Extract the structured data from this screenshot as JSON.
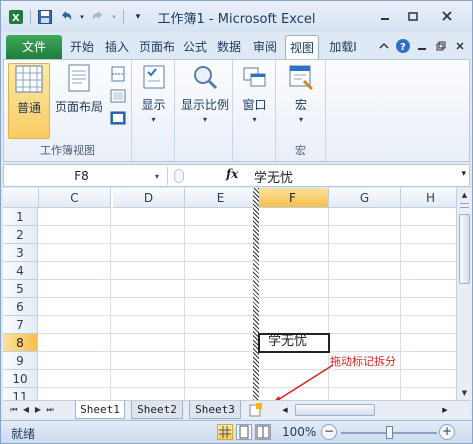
{
  "window": {
    "title": "工作簿1 - Microsoft Excel"
  },
  "ribbon_tabs": [
    {
      "label": "文件"
    },
    {
      "label": "开始"
    },
    {
      "label": "插入"
    },
    {
      "label": "页面布"
    },
    {
      "label": "公式"
    },
    {
      "label": "数据"
    },
    {
      "label": "审阅"
    },
    {
      "label": "视图"
    },
    {
      "label": "加载I"
    }
  ],
  "ribbon": {
    "workbook_views": {
      "group_label": "工作簿视图",
      "normal": "普通",
      "page_layout": "页面布局"
    },
    "show": {
      "label": "显示"
    },
    "zoom": {
      "label": "显示比例"
    },
    "window": {
      "label": "窗口"
    },
    "macros": {
      "label": "宏",
      "group_label": "宏"
    }
  },
  "formula_bar": {
    "name_box": "F8",
    "fx": "fx",
    "content": "学无忧"
  },
  "grid": {
    "columns": [
      "C",
      "D",
      "E",
      "F",
      "G",
      "H"
    ],
    "selected_column": "F",
    "rows": [
      "1",
      "2",
      "3",
      "4",
      "5",
      "6",
      "7",
      "8",
      "9",
      "10",
      "11"
    ],
    "selected_row": "8",
    "active_cell_text": "学无忧"
  },
  "annotation": {
    "text": "拖动标记拆分",
    "color": "#e02020"
  },
  "sheets": [
    "Sheet1",
    "Sheet2",
    "Sheet3"
  ],
  "status": {
    "ready": "就绪",
    "zoom": "100%"
  }
}
